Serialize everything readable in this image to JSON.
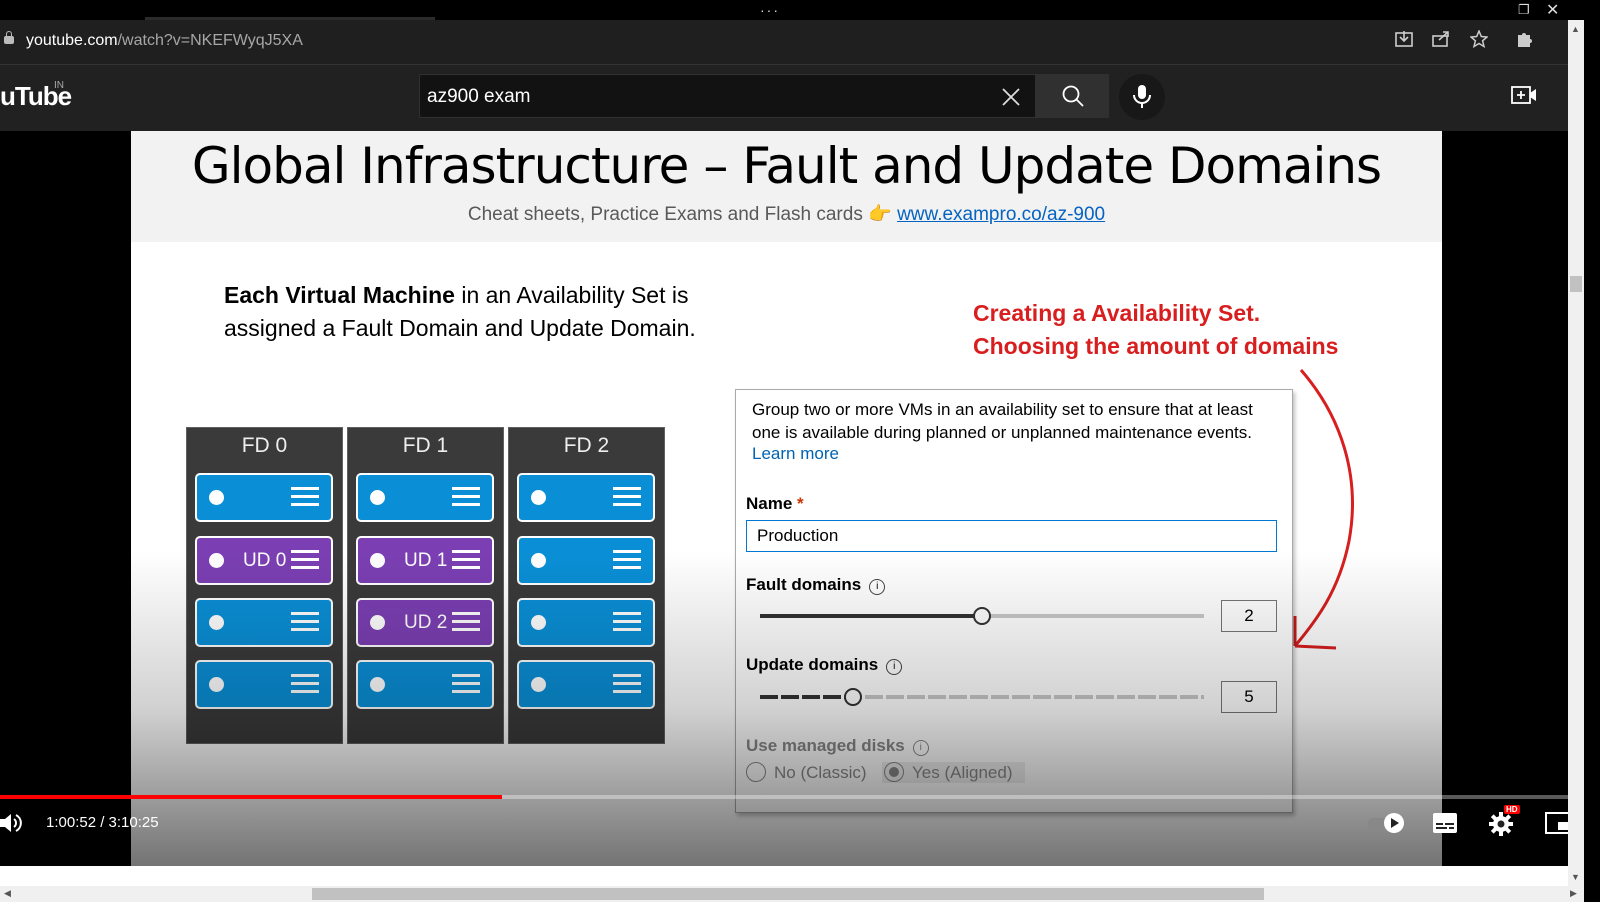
{
  "browser": {
    "more_glyph": "···",
    "url_host": "youtube.com",
    "url_path": "/watch?v=NKEFWyqJ5XA"
  },
  "youtube": {
    "logo": "uTube",
    "region": "IN",
    "search_value": "az900 exam"
  },
  "slide": {
    "title": "Global Infrastructure – Fault and Update Domains",
    "subtitle": "Cheat sheets, Practice Exams and Flash cards",
    "subtitle_link": "www.exampro.co/az-900",
    "para_bold": "Each Virtual Machine",
    "para_rest": " in an Availability Set is assigned a Fault Domain and Update Domain.",
    "note_line1": "Creating a Availability Set.",
    "note_line2": "Choosing the amount of domains",
    "racks": [
      {
        "label": "FD 0",
        "slots": [
          {
            "color": "blue",
            "ud": ""
          },
          {
            "color": "purple",
            "ud": "UD 0"
          },
          {
            "color": "blue",
            "ud": ""
          },
          {
            "color": "blue",
            "ud": ""
          }
        ]
      },
      {
        "label": "FD 1",
        "slots": [
          {
            "color": "blue",
            "ud": ""
          },
          {
            "color": "purple",
            "ud": "UD 1"
          },
          {
            "color": "purple",
            "ud": "UD 2"
          },
          {
            "color": "blue",
            "ud": ""
          }
        ]
      },
      {
        "label": "FD 2",
        "slots": [
          {
            "color": "blue",
            "ud": ""
          },
          {
            "color": "blue",
            "ud": ""
          },
          {
            "color": "blue",
            "ud": ""
          },
          {
            "color": "blue",
            "ud": ""
          }
        ]
      }
    ],
    "azure": {
      "description": "Group two or more VMs in an availability set to ensure that at least one is available during planned or unplanned maintenance events.",
      "learn_more": "Learn more",
      "name_label": "Name",
      "required_mark": "*",
      "name_value": "Production",
      "fault_label": "Fault domains",
      "fault_value": "2",
      "fault_fraction": 0.5,
      "update_label": "Update domains",
      "update_value": "5",
      "update_fraction": 0.21,
      "disks_label": "Use managed disks",
      "disks_no": "No (Classic)",
      "disks_yes": "Yes (Aligned)",
      "info_glyph": "i"
    }
  },
  "player": {
    "time_text": "1:00:52 / 3:10:25",
    "progress_fraction": 0.3204,
    "hd_badge": "HD"
  },
  "colors": {
    "progress": "#ff0000",
    "rack_blue": "#0a8fd6",
    "rack_purple": "#7b3fb3",
    "note_red": "#d81e1e",
    "link_blue": "#0563c1"
  }
}
